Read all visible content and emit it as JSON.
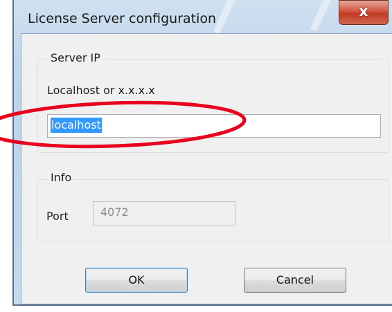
{
  "dialog": {
    "title": "License Server configuration",
    "close_glyph": "x"
  },
  "server_ip": {
    "group_label": "Server IP",
    "hint_label": "Localhost or x.x.x.x",
    "input_value": "localhost"
  },
  "info": {
    "group_label": "Info",
    "port_label": "Port",
    "port_value": "4072"
  },
  "buttons": {
    "ok": "OK",
    "cancel": "Cancel"
  },
  "annotation": {
    "color": "#e8001c"
  }
}
